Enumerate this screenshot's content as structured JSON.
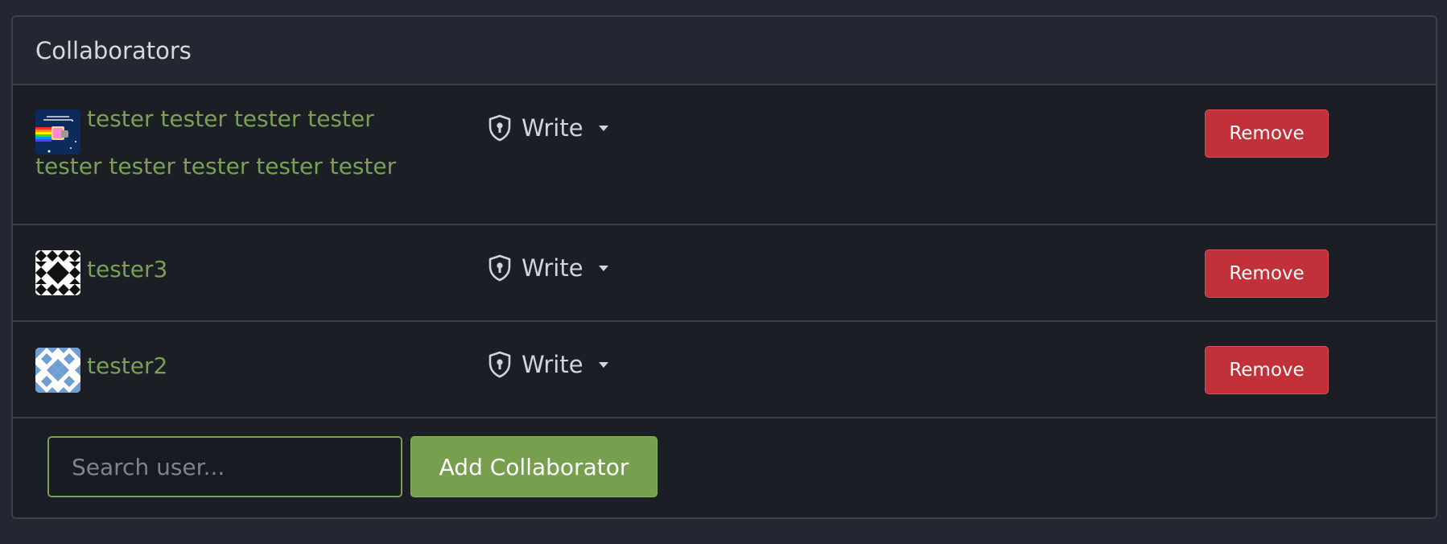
{
  "panel": {
    "title": "Collaborators"
  },
  "collaborators": [
    {
      "name": "tester tester tester tester tester tester tester tester tester",
      "permission": "Write",
      "remove_label": "Remove",
      "avatar_icon": "nyan-cat-avatar"
    },
    {
      "name": "tester3",
      "permission": "Write",
      "remove_label": "Remove",
      "avatar_icon": "identicon-avatar"
    },
    {
      "name": "tester2",
      "permission": "Write",
      "remove_label": "Remove",
      "avatar_icon": "identicon-avatar"
    }
  ],
  "add": {
    "search_placeholder": "Search user...",
    "search_value": "",
    "button_label": "Add Collaborator"
  },
  "colors": {
    "background": "#242732",
    "panel": "#1c1e26",
    "link_green": "#7aa054",
    "primary_green": "#76a04e",
    "danger_red": "#c2313a"
  }
}
